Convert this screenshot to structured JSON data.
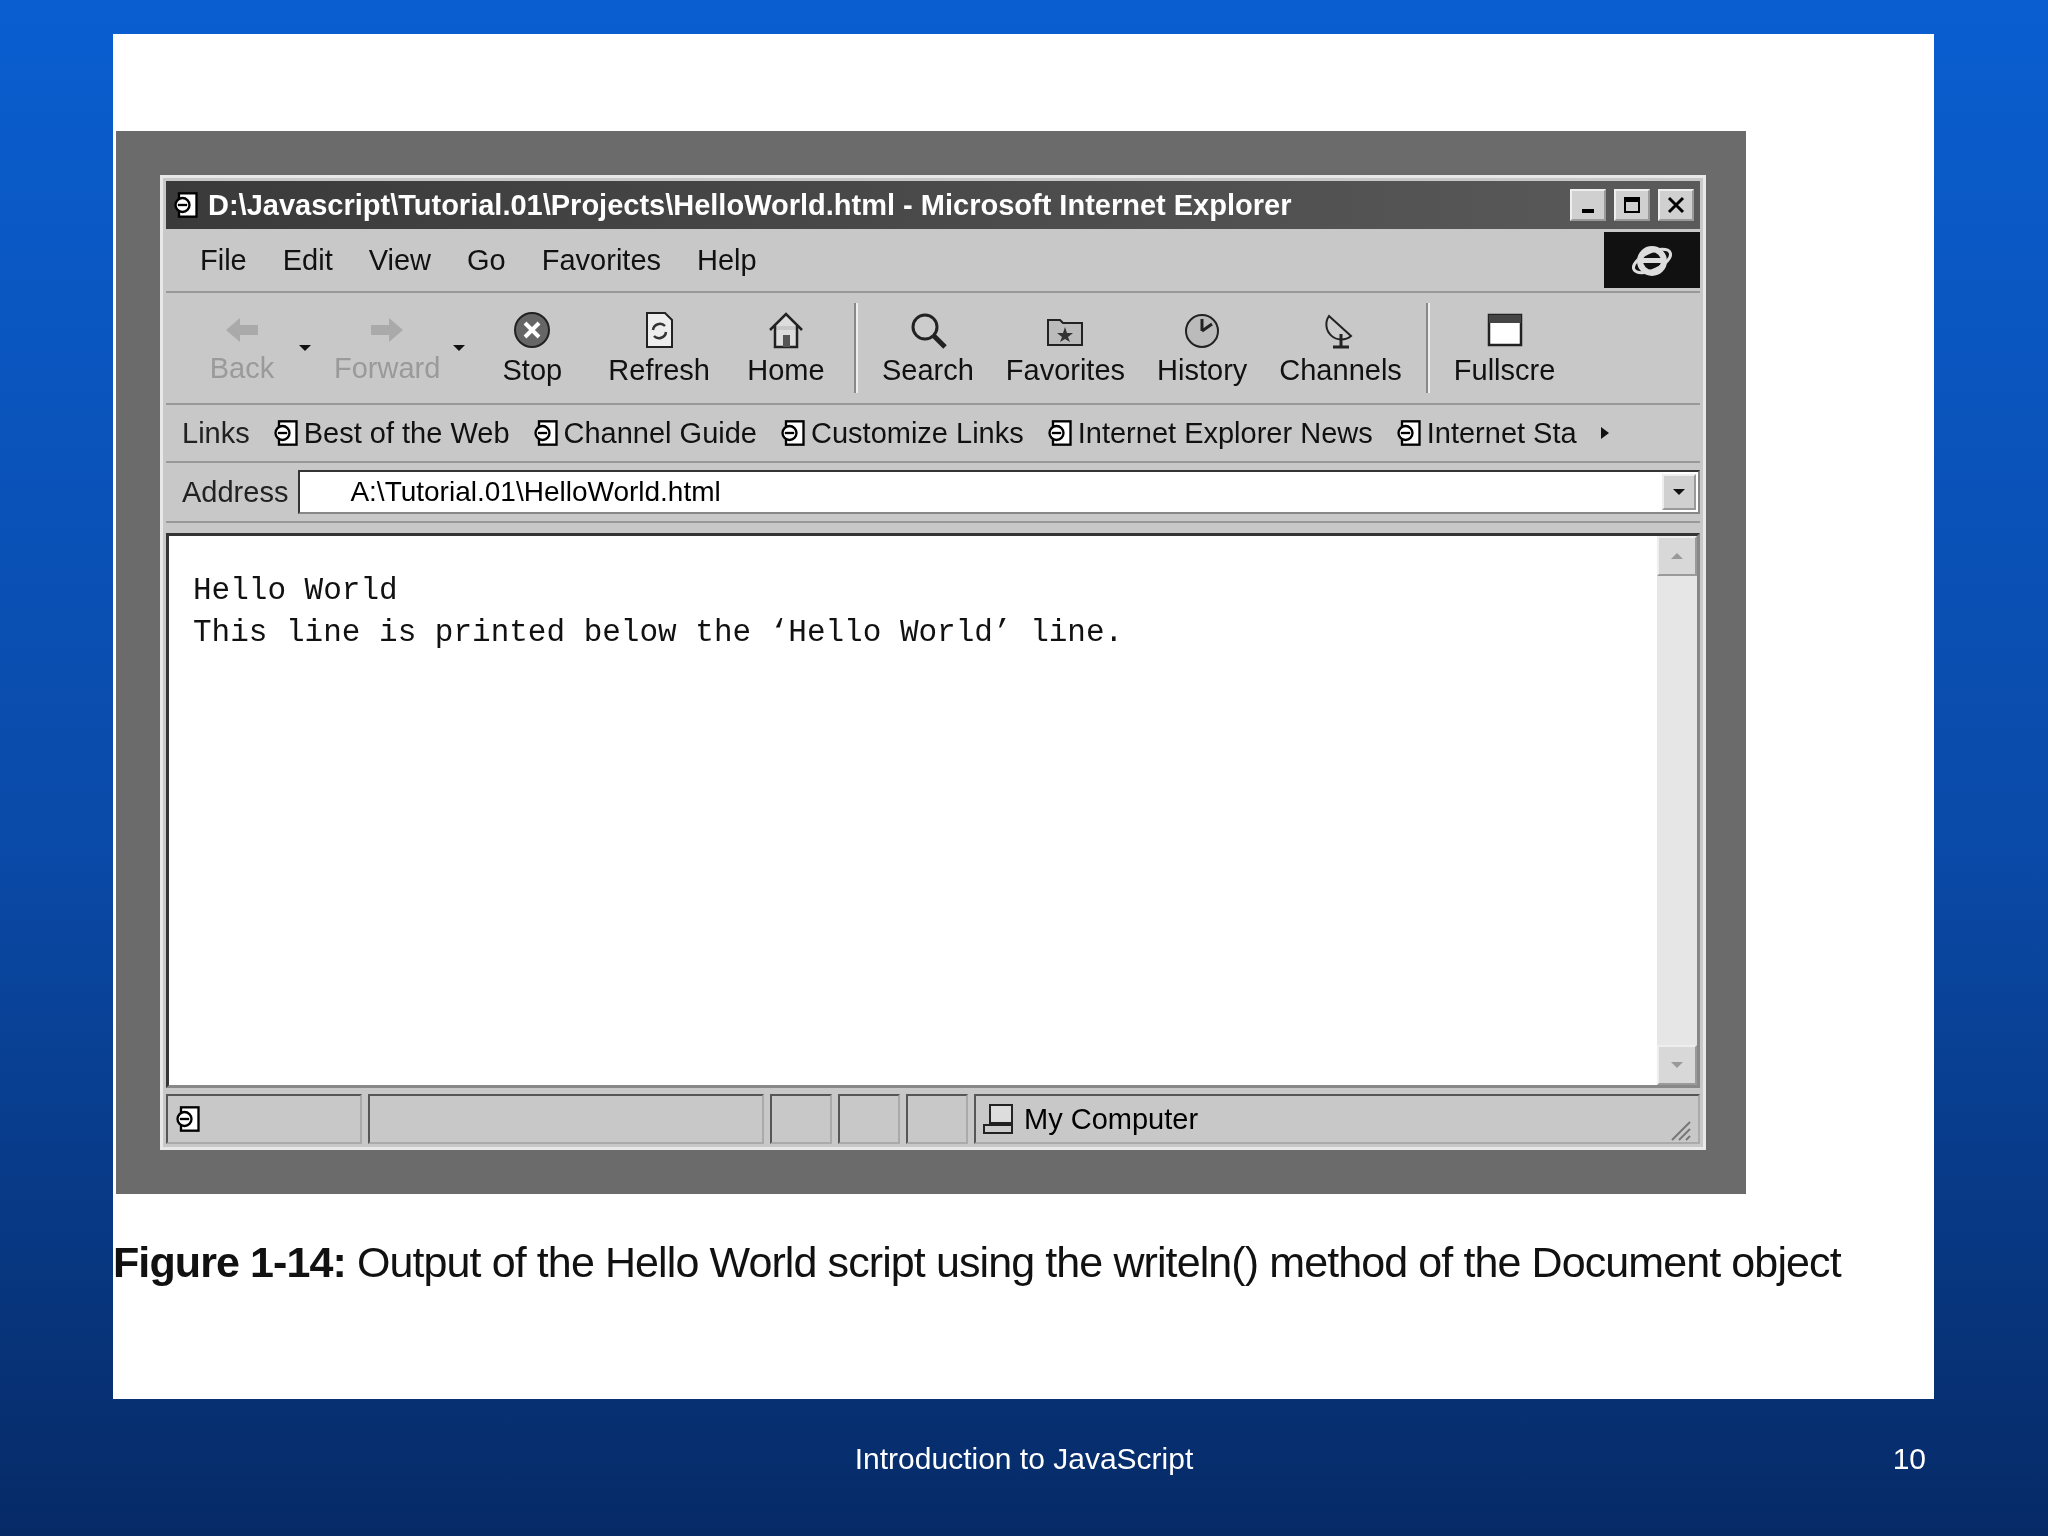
{
  "window": {
    "title": "D:\\Javascript\\Tutorial.01\\Projects\\HelloWorld.html - Microsoft Internet Explorer"
  },
  "menu": [
    "File",
    "Edit",
    "View",
    "Go",
    "Favorites",
    "Help"
  ],
  "toolbar": [
    {
      "label": "Back",
      "kind": "back",
      "disabled": true,
      "dropdown": true
    },
    {
      "label": "Forward",
      "kind": "forward",
      "disabled": true,
      "dropdown": true
    },
    {
      "label": "Stop",
      "kind": "stop",
      "disabled": false,
      "dropdown": false
    },
    {
      "label": "Refresh",
      "kind": "refresh",
      "disabled": false,
      "dropdown": false
    },
    {
      "label": "Home",
      "kind": "home",
      "disabled": false,
      "dropdown": false
    },
    {
      "label": "Search",
      "kind": "search",
      "disabled": false,
      "dropdown": false
    },
    {
      "label": "Favorites",
      "kind": "favorites",
      "disabled": false,
      "dropdown": false
    },
    {
      "label": "History",
      "kind": "history",
      "disabled": false,
      "dropdown": false
    },
    {
      "label": "Channels",
      "kind": "channels",
      "disabled": false,
      "dropdown": false
    },
    {
      "label": "Fullscre",
      "kind": "fullscreen",
      "disabled": false,
      "dropdown": false
    }
  ],
  "links": {
    "label": "Links",
    "items": [
      "Best of the Web",
      "Channel Guide",
      "Customize Links",
      "Internet Explorer News",
      "Internet Sta"
    ]
  },
  "address": {
    "label": "Address",
    "value": "A:\\Tutorial.01\\HelloWorld.html"
  },
  "content": [
    "Hello World",
    "This line is printed below the ‘Hello World’ line."
  ],
  "status_bar": {
    "zone": "My Computer"
  },
  "caption": "**Figure 1-14:** Output of the Hello World script using the writeln() method of the Document object",
  "footer": {
    "title": "Introduction to JavaScript",
    "page": "10"
  }
}
